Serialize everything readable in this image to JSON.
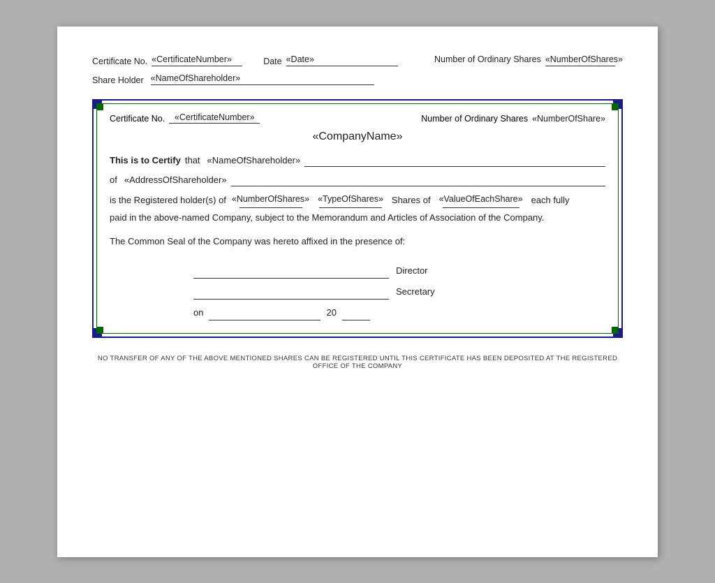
{
  "page": {
    "background": "#b0b0b0",
    "document_bg": "#ffffff"
  },
  "top_section": {
    "cert_no_label": "Certificate No.",
    "cert_no_value": "«CertificateNumber»",
    "date_label": "Date",
    "date_value": "«Date»",
    "ordinary_shares_label": "Number of Ordinary Shares",
    "ordinary_shares_value": "«NumberOfShares»",
    "share_holder_label": "Share Holder",
    "share_holder_value": "«NameOfShareholder»"
  },
  "certificate": {
    "cert_no_label": "Certificate No.",
    "cert_no_value": "«CertificateNumber»",
    "ordinary_shares_label": "Number of Ordinary Shares",
    "ordinary_shares_value": "«NumberOfShare»",
    "company_name": "«CompanyName»",
    "certify_text": "This is to Certify",
    "certify_that": "that",
    "name_of_shareholder": "«NameOfShareholder»",
    "of_label": "of",
    "address_of_shareholder": "«AddressOfShareholder»",
    "is_registered": "is the Registered holder(s) of",
    "number_of_shares_field": "«NumberOfShares»",
    "type_of_shares_field": "«TypeOfShares»",
    "shares_of": "Shares of",
    "value_each_field": "«ValueOfEachShare»",
    "each_fully": "each fully",
    "paid_line": "paid in the above-named Company, subject to the Memorandum and Articles of Association of the Company.",
    "seal_line": "The Common Seal of the Company was hereto affixed in the presence of:",
    "director_label": "Director",
    "secretary_label": "Secretary",
    "on_label": "on",
    "year_label": "20"
  },
  "footer": {
    "text": "NO TRANSFER OF ANY OF THE ABOVE MENTIONED SHARES CAN BE REGISTERED UNTIL THIS CERTIFICATE HAS BEEN DEPOSITED AT THE REGISTERED OFFICE OF THE COMPANY"
  }
}
